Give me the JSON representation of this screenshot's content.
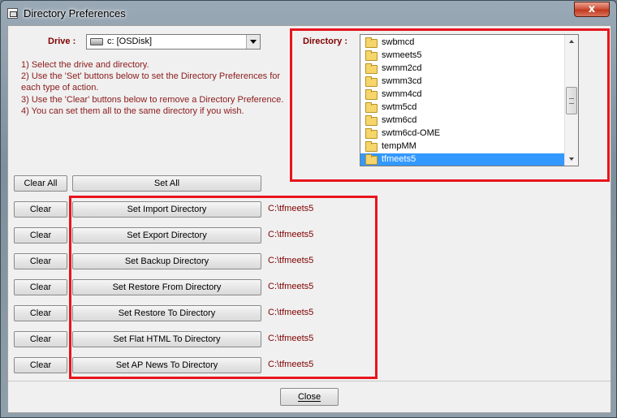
{
  "window": {
    "title": "Directory Preferences",
    "close_glyph": "x"
  },
  "drive": {
    "label": "Drive :",
    "value": "c: [OSDisk]"
  },
  "instructions": [
    "1) Select the drive and directory.",
    "2) Use the 'Set' buttons below to set the Directory Preferences for",
    "each type of action.",
    "3) Use the 'Clear' buttons below to remove a Directory Preference.",
    "4) You can set them all to the same directory if you wish."
  ],
  "directory": {
    "label": "Directory :",
    "items": [
      "swbmcd",
      "swmeets5",
      "swmm2cd",
      "swmm3cd",
      "swmm4cd",
      "swtm5cd",
      "swtm6cd",
      "swtm6cd-OME",
      "tempMM",
      "tfmeets5"
    ],
    "selected": "tfmeets5"
  },
  "bulk": {
    "clear_all": "Clear All",
    "set_all": "Set All"
  },
  "rows": [
    {
      "clear": "Clear",
      "set": "Set Import Directory",
      "path": "C:\\tfmeets5"
    },
    {
      "clear": "Clear",
      "set": "Set Export Directory",
      "path": "C:\\tfmeets5"
    },
    {
      "clear": "Clear",
      "set": "Set Backup Directory",
      "path": "C:\\tfmeets5"
    },
    {
      "clear": "Clear",
      "set": "Set Restore From Directory",
      "path": "C:\\tfmeets5"
    },
    {
      "clear": "Clear",
      "set": "Set Restore To Directory",
      "path": "C:\\tfmeets5"
    },
    {
      "clear": "Clear",
      "set": "Set Flat HTML To Directory",
      "path": "C:\\tfmeets5"
    },
    {
      "clear": "Clear",
      "set": "Set AP News To Directory",
      "path": "C:\\tfmeets5"
    }
  ],
  "footer": {
    "close_label": "Close"
  },
  "colors": {
    "label_text": "#800000",
    "highlight": "#e8141c",
    "selection": "#3399ff"
  },
  "icons": {
    "drive": "hard-drive-icon",
    "folder": "folder-icon"
  }
}
